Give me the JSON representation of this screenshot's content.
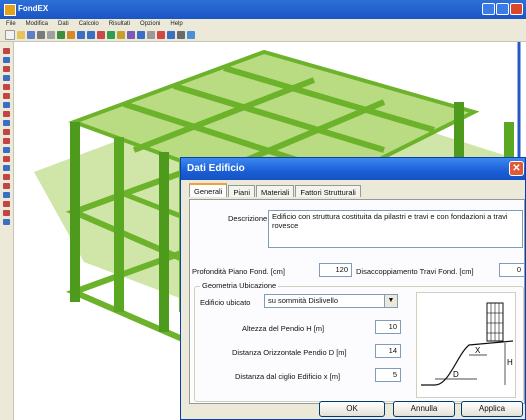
{
  "app": {
    "title": "FondEX"
  },
  "menu": [
    "File",
    "Modifica",
    "Dati",
    "Calcolo",
    "Risultati",
    "Opzioni",
    "Help"
  ],
  "dialog": {
    "title": "Dati Edificio",
    "close_glyph": "✕",
    "tabs": [
      "Generali",
      "Piani",
      "Materiali",
      "Fattori Strutturali"
    ],
    "active_tab": "Generali",
    "descrizione": {
      "label": "Descrizione",
      "value": "Edificio con struttura costituita da pilastri e travi e con fondazioni a travi rovesce"
    },
    "profondita": {
      "label": "Profondità Piano Fond. [cm]",
      "value": "120"
    },
    "disaccoppiamento": {
      "label": "Disaccoppiamento Travi Fond. [cm]",
      "value": "0"
    },
    "geometria": {
      "title": "Geometria Ubicazione",
      "edificio_label": "Edificio ubicato",
      "edificio_value": "su sommità Dislivello",
      "altezza_label": "Altezza del Pendio H [m]",
      "altezza_value": "10",
      "distanza_d_label": "Distanza Orizzontale Pendio D [m]",
      "distanza_d_value": "14",
      "distanza_x_label": "Distanza dal ciglio Edificio x [m]",
      "distanza_x_value": "5",
      "diagram_labels": {
        "x": "X",
        "h": "H",
        "d": "D"
      }
    },
    "buttons": {
      "ok": "OK",
      "annulla": "Annulla",
      "applica": "Applica"
    }
  },
  "colors": {
    "titlebar": "#1b55c4",
    "dialog_bg": "#ece9d8",
    "structure_dark": "#4e9a1c",
    "structure_light": "#8ccc3a",
    "slab": "#cfe6a8"
  }
}
